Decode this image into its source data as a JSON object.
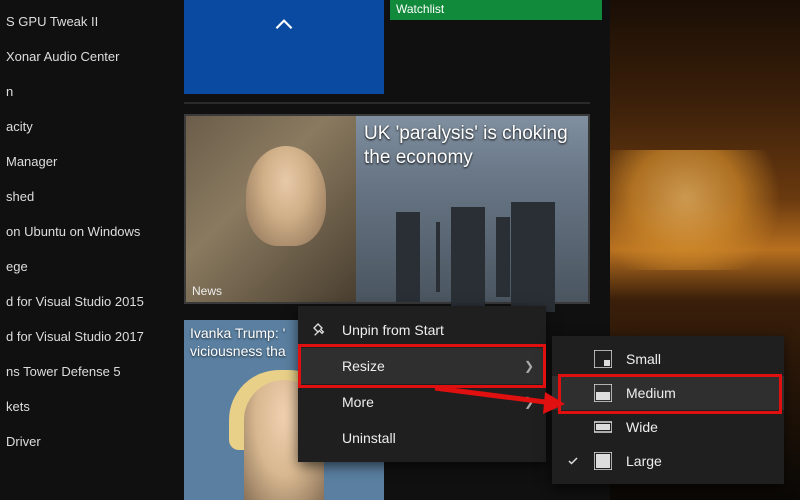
{
  "applist": {
    "items": [
      {
        "label": "S GPU Tweak II"
      },
      {
        "label": "Xonar Audio Center"
      },
      {
        "label": "n"
      },
      {
        "label": "acity"
      },
      {
        "label": " Manager"
      },
      {
        "label": "shed"
      },
      {
        "label": " on Ubuntu on Windows"
      },
      {
        "label": "ege"
      },
      {
        "label": "d for Visual Studio 2015"
      },
      {
        "label": "d for Visual Studio 2017"
      },
      {
        "label": "ns Tower Defense 5"
      },
      {
        "label": "kets"
      },
      {
        "label": "Driver"
      }
    ]
  },
  "tiles": {
    "watchlist_label": "Watchlist",
    "news": {
      "headline": "UK 'paralysis' is choking the economy",
      "app_label": "News"
    },
    "ivanka": {
      "caption_line1": "Ivanka Trump: '",
      "caption_line2": "viciousness tha"
    }
  },
  "context_menu": {
    "unpin": "Unpin from Start",
    "resize": "Resize",
    "more": "More",
    "uninstall": "Uninstall"
  },
  "resize_menu": {
    "small": "Small",
    "medium": "Medium",
    "wide": "Wide",
    "large": "Large",
    "current": "large"
  }
}
